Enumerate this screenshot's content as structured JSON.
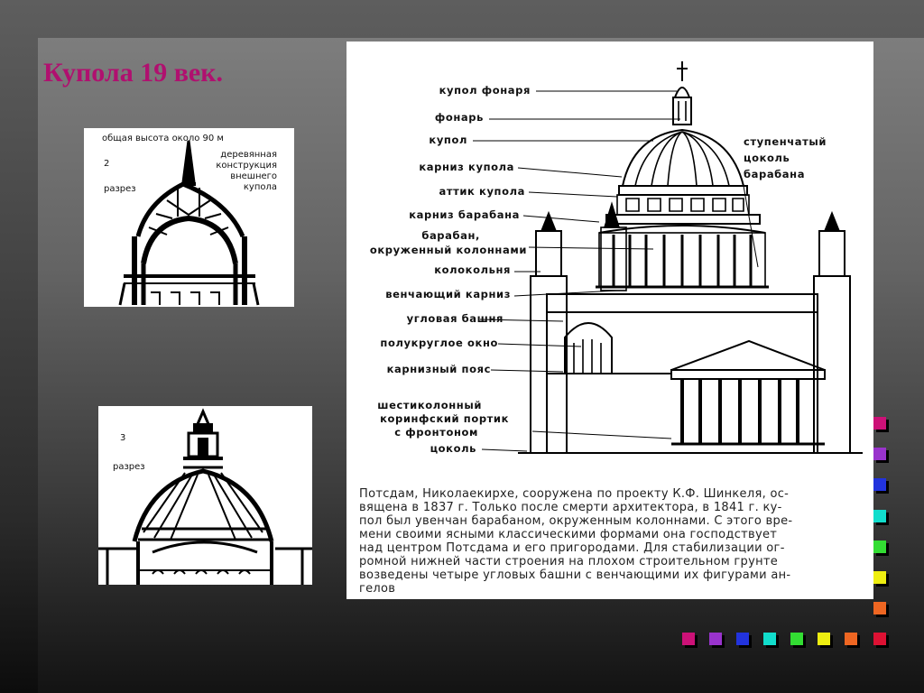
{
  "slide": {
    "title": "Купола 19 век."
  },
  "section2": {
    "number": "2",
    "section_label": "разрез",
    "height_label": "общая высота около 90 м",
    "structure_label": [
      "деревянная",
      "конструкция",
      "внешнего",
      "купола"
    ]
  },
  "section3": {
    "number": "3",
    "section_label": "разрез"
  },
  "main": {
    "callouts_left": [
      "купол фонаря",
      "фонарь",
      "купол",
      "карниз купола",
      "аттик купола",
      "карниз барабана",
      "барабан,",
      "окруженный колоннами",
      "колокольня",
      "венчающий карниз",
      "угловая башня",
      "полукруглое окно",
      "карнизный пояс",
      "шестиколонный",
      "коринфский портик",
      "с фронтоном",
      "цоколь"
    ],
    "callout_right": [
      "ступенчатый",
      "цоколь",
      "барабана"
    ],
    "caption_lines": [
      "Потсдам, Николаекирхе, сооружена по проекту К.Ф. Шинкеля, ос-",
      "вящена в 1837 г. Только после смерти архитектора, в 1841 г. ку-",
      "пол был увенчан барабаном, окруженным колоннами. С этого вре-",
      "мени своими ясными классическими формами она господствует",
      "над центром Потсдама и его пригородами. Для стабилизации ог-",
      "ромной нижней части строения на плохом строительном грунте",
      "возведены четыре угловых башни с венчающими их фигурами ан-",
      "гелов"
    ]
  },
  "decor": {
    "square_colors": [
      "#cc1177",
      "#9933cc",
      "#2233dd",
      "#11ddcc",
      "#33dd33",
      "#eeee11",
      "#ee6622",
      "#dd1133"
    ]
  }
}
